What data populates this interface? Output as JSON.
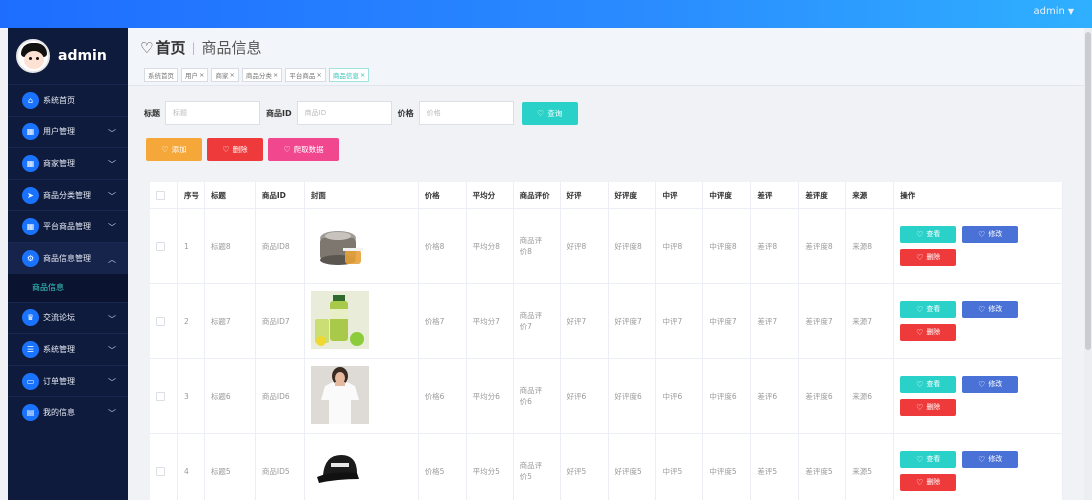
{
  "topbar": {
    "user": "admin"
  },
  "sidebar": {
    "username": "admin",
    "items": [
      {
        "label": "系统首页",
        "icon": "home-icon",
        "glyph": "⌂",
        "has_chevron": false
      },
      {
        "label": "用户管理",
        "icon": "grid-icon",
        "glyph": "▦",
        "has_chevron": true
      },
      {
        "label": "商家管理",
        "icon": "grid-icon",
        "glyph": "▦",
        "has_chevron": true
      },
      {
        "label": "商品分类管理",
        "icon": "send-icon",
        "glyph": "➤",
        "has_chevron": true
      },
      {
        "label": "平台商品管理",
        "icon": "grid-icon",
        "glyph": "▦",
        "has_chevron": true
      },
      {
        "label": "商品信息管理",
        "icon": "gear-icon",
        "glyph": "⚙",
        "has_chevron": true,
        "expanded": true
      },
      {
        "label": "交流论坛",
        "icon": "trophy-icon",
        "glyph": "♛",
        "has_chevron": true
      },
      {
        "label": "系统管理",
        "icon": "list-icon",
        "glyph": "☰",
        "has_chevron": true
      },
      {
        "label": "订单管理",
        "icon": "ticket-icon",
        "glyph": "▭",
        "has_chevron": true
      },
      {
        "label": "我的信息",
        "icon": "card-icon",
        "glyph": "▤",
        "has_chevron": true
      }
    ],
    "submenu": {
      "label": "商品信息"
    }
  },
  "header": {
    "home": "首页",
    "crumb": "商品信息",
    "tags": [
      {
        "label": "系统首页",
        "closable": false,
        "active": false
      },
      {
        "label": "用户",
        "closable": true,
        "active": false
      },
      {
        "label": "商家",
        "closable": true,
        "active": false
      },
      {
        "label": "商品分类",
        "closable": true,
        "active": false
      },
      {
        "label": "平台商品",
        "closable": true,
        "active": false
      },
      {
        "label": "商品信息",
        "closable": true,
        "active": true
      }
    ]
  },
  "search": {
    "title_label": "标题",
    "title_placeholder": "标题",
    "id_label": "商品ID",
    "id_placeholder": "商品ID",
    "price_label": "价格",
    "price_placeholder": "价格",
    "query_label": "查询"
  },
  "actions": {
    "add": "添加",
    "delete": "删除",
    "fetch": "爬取数据"
  },
  "table": {
    "headers": [
      "序号",
      "标题",
      "商品ID",
      "封面",
      "价格",
      "平均分",
      "商品评价",
      "好评",
      "好评度",
      "中评",
      "中评度",
      "差评",
      "差评度",
      "来源",
      "操作"
    ],
    "rows": [
      {
        "no": "1",
        "title": "标题8",
        "pid": "商品ID8",
        "cover": "rice-cooker",
        "price": "价格8",
        "avg": "平均分8",
        "review": "商品评价8",
        "good": "好评8",
        "good_rate": "好评度8",
        "mid": "中评8",
        "mid_rate": "中评度8",
        "bad": "差评8",
        "bad_rate": "差评度8",
        "source": "来源8"
      },
      {
        "no": "2",
        "title": "标题7",
        "pid": "商品ID7",
        "cover": "juice",
        "price": "价格7",
        "avg": "平均分7",
        "review": "商品评价7",
        "good": "好评7",
        "good_rate": "好评度7",
        "mid": "中评7",
        "mid_rate": "中评度7",
        "bad": "差评7",
        "bad_rate": "差评度7",
        "source": "来源7"
      },
      {
        "no": "3",
        "title": "标题6",
        "pid": "商品ID6",
        "cover": "tshirt",
        "price": "价格6",
        "avg": "平均分6",
        "review": "商品评价6",
        "good": "好评6",
        "good_rate": "好评度6",
        "mid": "中评6",
        "mid_rate": "中评度6",
        "bad": "差评6",
        "bad_rate": "差评度6",
        "source": "来源6"
      },
      {
        "no": "4",
        "title": "标题5",
        "pid": "商品ID5",
        "cover": "cap",
        "price": "价格5",
        "avg": "平均分5",
        "review": "商品评价5",
        "good": "好评5",
        "good_rate": "好评度5",
        "mid": "中评5",
        "mid_rate": "中评度5",
        "bad": "差评5",
        "bad_rate": "差评度5",
        "source": "来源5"
      }
    ],
    "row_buttons": {
      "view": "查看",
      "edit": "修改",
      "delete": "删除"
    }
  }
}
